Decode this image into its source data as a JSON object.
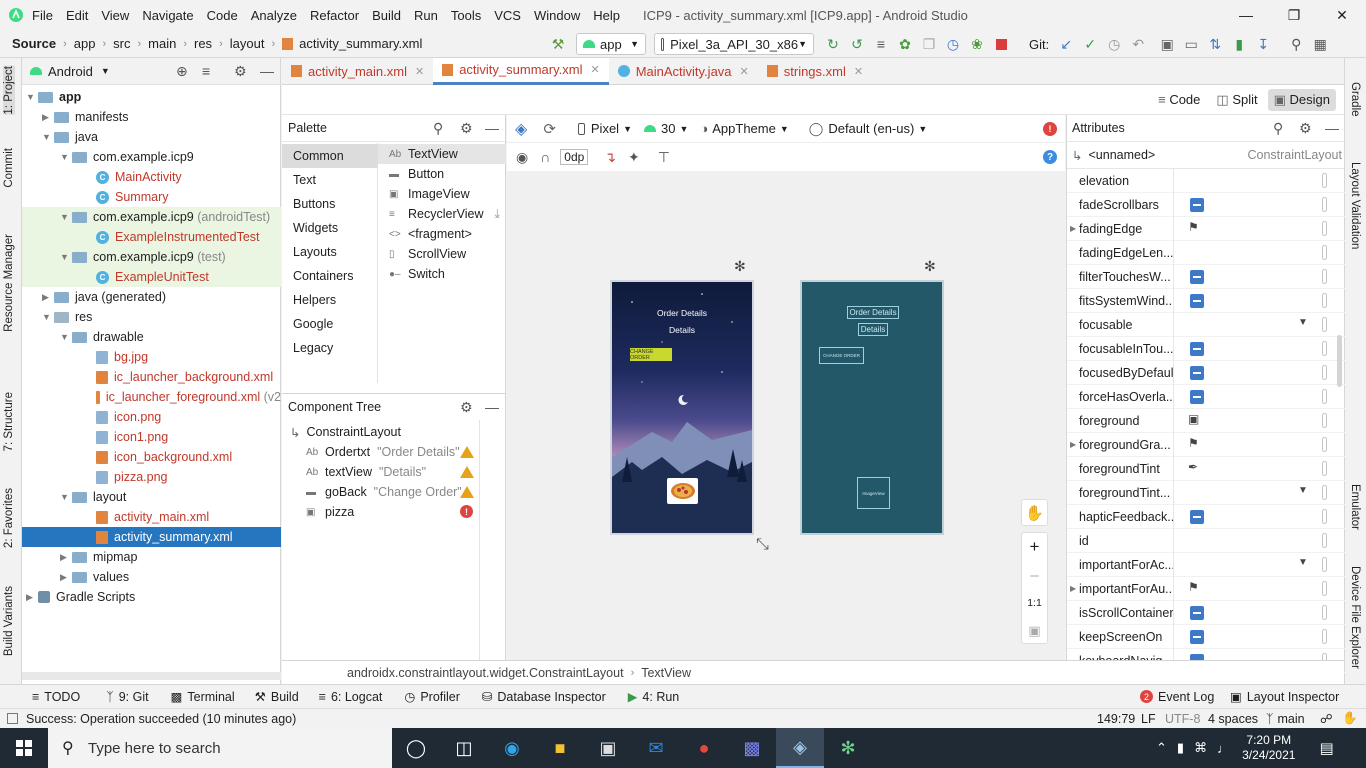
{
  "window": {
    "menu": [
      "File",
      "Edit",
      "View",
      "Navigate",
      "Code",
      "Analyze",
      "Refactor",
      "Build",
      "Run",
      "Tools",
      "VCS",
      "Window",
      "Help"
    ],
    "title": "ICP9 - activity_summary.xml [ICP9.app] - Android Studio"
  },
  "navbar": {
    "breadcrumbs": [
      "Source",
      "app",
      "src",
      "main",
      "res",
      "layout",
      "activity_summary.xml"
    ],
    "run_config": "app",
    "device": "Pixel_3a_API_30_x86",
    "git_label": "Git:"
  },
  "left_stripe": {
    "project": "1: Project",
    "commit": "Commit",
    "resource_manager": "Resource Manager",
    "structure": "7: Structure",
    "favorites": "2: Favorites",
    "build_variants": "Build Variants"
  },
  "right_stripe": {
    "gradle": "Gradle",
    "layout_validation": "Layout Validation",
    "emulator": "Emulator",
    "device_explorer": "Device File Explorer"
  },
  "project": {
    "view_mode": "Android",
    "tree": [
      {
        "label": "app",
        "extra": ""
      },
      {
        "label": "manifests",
        "extra": ""
      },
      {
        "label": "java",
        "extra": ""
      },
      {
        "label": "com.example.icp9",
        "extra": ""
      },
      {
        "label": "MainActivity",
        "extra": ""
      },
      {
        "label": "Summary",
        "extra": ""
      },
      {
        "label": "com.example.icp9",
        "extra": "(androidTest)"
      },
      {
        "label": "ExampleInstrumentedTest",
        "extra": ""
      },
      {
        "label": "com.example.icp9",
        "extra": "(test)"
      },
      {
        "label": "ExampleUnitTest",
        "extra": ""
      },
      {
        "label": "java (generated)",
        "extra": ""
      },
      {
        "label": "res",
        "extra": ""
      },
      {
        "label": "drawable",
        "extra": ""
      },
      {
        "label": "bg.jpg",
        "extra": ""
      },
      {
        "label": "ic_launcher_background.xml",
        "extra": ""
      },
      {
        "label": "ic_launcher_foreground.xml",
        "extra": "(v2"
      },
      {
        "label": "icon.png",
        "extra": ""
      },
      {
        "label": "icon1.png",
        "extra": ""
      },
      {
        "label": "icon_background.xml",
        "extra": ""
      },
      {
        "label": "pizza.png",
        "extra": ""
      },
      {
        "label": "layout",
        "extra": ""
      },
      {
        "label": "activity_main.xml",
        "extra": ""
      },
      {
        "label": "activity_summary.xml",
        "extra": ""
      },
      {
        "label": "mipmap",
        "extra": ""
      },
      {
        "label": "values",
        "extra": ""
      },
      {
        "label": "Gradle Scripts",
        "extra": ""
      }
    ]
  },
  "editor_tabs": [
    "activity_main.xml",
    "activity_summary.xml",
    "MainActivity.java",
    "strings.xml"
  ],
  "modes": [
    "Code",
    "Split",
    "Design"
  ],
  "palette": {
    "title": "Palette",
    "categories": [
      "Common",
      "Text",
      "Buttons",
      "Widgets",
      "Layouts",
      "Containers",
      "Helpers",
      "Google",
      "Legacy"
    ],
    "items": [
      "TextView",
      "Button",
      "ImageView",
      "RecyclerView",
      "<fragment>",
      "ScrollView",
      "Switch"
    ]
  },
  "component_tree": {
    "title": "Component Tree",
    "root": "ConstraintLayout",
    "children": [
      {
        "name": "Ordertxt",
        "text": "\"Order Details\""
      },
      {
        "name": "textView",
        "text": "\"Details\""
      },
      {
        "name": "goBack",
        "text": "\"Change Order\""
      },
      {
        "name": "pizza",
        "text": ""
      }
    ]
  },
  "design_toolbar": {
    "device": "Pixel",
    "api": "30",
    "theme": "AppTheme",
    "locale": "Default (en-us)",
    "margin": "0dp"
  },
  "preview": {
    "title": "Order Details",
    "subtitle": "Details",
    "button": "CHANGE ORDER",
    "blueprint_title": "Order Details",
    "blueprint_subtitle": "Details",
    "blueprint_button": "CHANGE ORDER",
    "blueprint_image": "ImageView"
  },
  "zoom": {
    "reset": "1:1"
  },
  "attributes": {
    "title": "Attributes",
    "component": "<unnamed>",
    "component_type": "ConstraintLayout",
    "rows": [
      {
        "name": "elevation",
        "type": "blank"
      },
      {
        "name": "fadeScrollbars",
        "type": "toggle"
      },
      {
        "name": "fadingEdge",
        "type": "flag"
      },
      {
        "name": "fadingEdgeLen...",
        "type": "blank"
      },
      {
        "name": "filterTouchesW...",
        "type": "toggle"
      },
      {
        "name": "fitsSystemWind...",
        "type": "toggle"
      },
      {
        "name": "focusable",
        "type": "dropdown"
      },
      {
        "name": "focusableInTou...",
        "type": "toggle"
      },
      {
        "name": "focusedByDefault",
        "type": "toggle"
      },
      {
        "name": "forceHasOverla...",
        "type": "toggle"
      },
      {
        "name": "foreground",
        "type": "image"
      },
      {
        "name": "foregroundGra...",
        "type": "flag"
      },
      {
        "name": "foregroundTint",
        "type": "dropper"
      },
      {
        "name": "foregroundTint...",
        "type": "dropdown"
      },
      {
        "name": "hapticFeedback...",
        "type": "toggle"
      },
      {
        "name": "id",
        "type": "blank"
      },
      {
        "name": "importantForAc...",
        "type": "dropdown"
      },
      {
        "name": "importantForAu...",
        "type": "flag"
      },
      {
        "name": "isScrollContainer",
        "type": "toggle"
      },
      {
        "name": "keepScreenOn",
        "type": "toggle"
      },
      {
        "name": "keyboardNavig...",
        "type": "toggle"
      }
    ]
  },
  "bottom_crumb": {
    "path": "androidx.constraintlayout.widget.ConstraintLayout",
    "leaf": "TextView"
  },
  "bottom_tools": [
    "TODO",
    "9: Git",
    "Terminal",
    "Build",
    "6: Logcat",
    "Profiler",
    "Database Inspector",
    "4: Run"
  ],
  "bottom_right_tools": {
    "event_log": "Event Log",
    "event_count": "2",
    "layout_inspector": "Layout Inspector"
  },
  "status": {
    "message": "Success: Operation succeeded (10 minutes ago)",
    "position": "149:79",
    "line_sep": "LF",
    "encoding": "UTF-8",
    "indent": "4 spaces",
    "branch": "main"
  },
  "taskbar": {
    "search_placeholder": "Type here to search",
    "time": "7:20 PM",
    "date": "3/24/2021"
  },
  "colors": {
    "accent": "#2675bf",
    "toggle": "#3d79c7",
    "blueprint": "#235868",
    "taskbar": "#1f2a35"
  }
}
